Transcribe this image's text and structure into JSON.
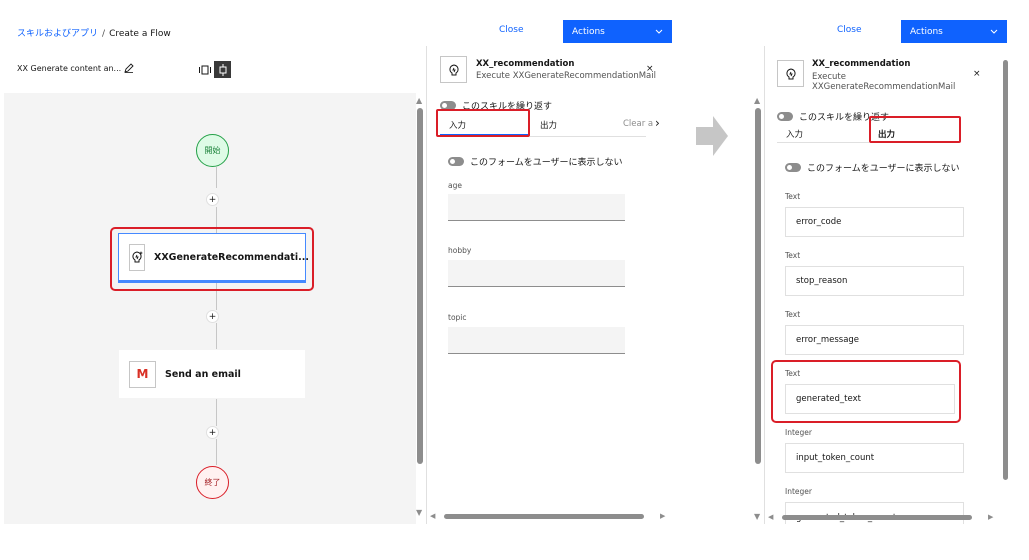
{
  "breadcrumb": {
    "parent": "スキルおよびアプリ",
    "separator": "/",
    "current": "Create a Flow"
  },
  "flow": {
    "name": "XX Generate content an...",
    "start_label": "開始",
    "end_label": "終了",
    "plus": "+",
    "node1": {
      "label": "XXGenerateRecommendati..."
    },
    "node2": {
      "label": "Send an email",
      "icon": "M"
    }
  },
  "panel1": {
    "close": "Close",
    "actions": "Actions",
    "title": "XX_recommendation",
    "subtitle": "Execute XXGenerateRecommendationMail",
    "close_x": "×",
    "repeat_label": "このスキルを繰り返す",
    "tabs": {
      "input": "入力",
      "output": "出力",
      "clear": "Clear a",
      "next": "›"
    },
    "hide_form_label": "このフォームをユーザーに表示しない",
    "fields": [
      "age",
      "hobby",
      "topic"
    ]
  },
  "panel2": {
    "close": "Close",
    "actions": "Actions",
    "title": "XX_recommendation",
    "subtitle_line1": "Execute",
    "subtitle_line2": "XXGenerateRecommendationMail",
    "close_x": "×",
    "repeat_label": "このスキルを繰り返す",
    "tabs": {
      "input": "入力",
      "output": "出力"
    },
    "hide_form_label": "このフォームをユーザーに表示しない",
    "outputs": [
      {
        "type": "Text",
        "name": "error_code"
      },
      {
        "type": "Text",
        "name": "stop_reason"
      },
      {
        "type": "Text",
        "name": "error_message"
      },
      {
        "type": "Text",
        "name": "generated_text"
      },
      {
        "type": "Integer",
        "name": "input_token_count"
      },
      {
        "type": "Integer",
        "name": "generated_token_count"
      }
    ]
  },
  "icons": [
    "edit-icon",
    "view-toggle-icon",
    "skill-icon",
    "gmail-icon",
    "chevron-down-icon",
    "close-icon",
    "arrow-right-icon"
  ],
  "colors": {
    "accent": "#0f62fe",
    "highlight": "#da1e28",
    "start": "#24a148",
    "end": "#da1e28"
  }
}
